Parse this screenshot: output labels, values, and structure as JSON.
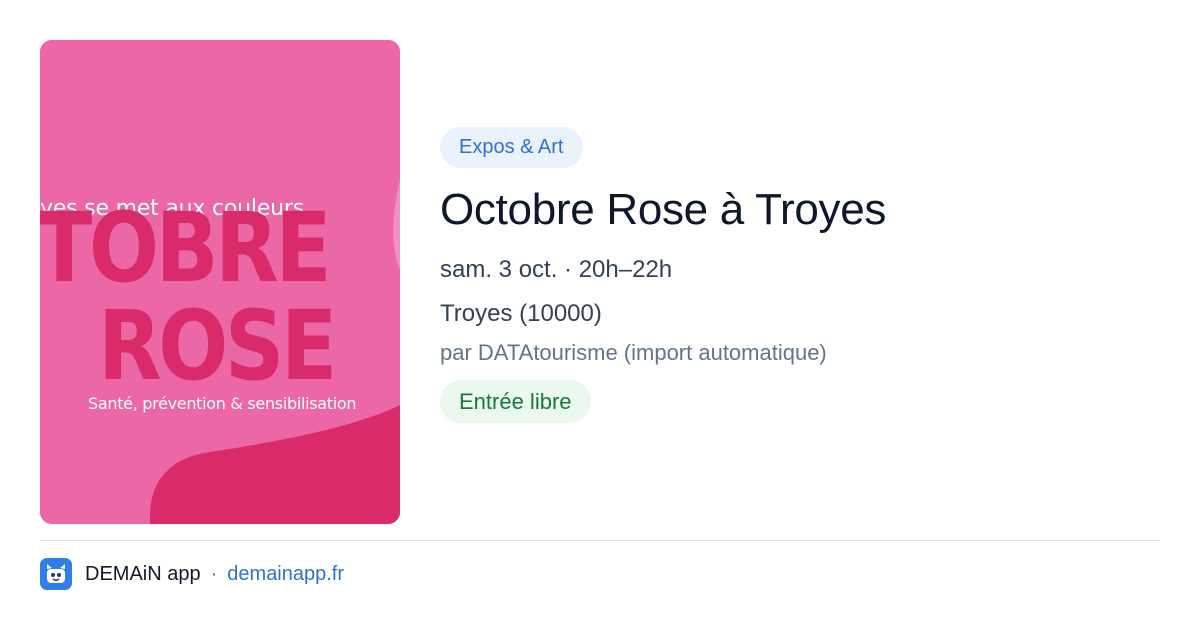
{
  "poster": {
    "tagline": "yes se met aux couleurs",
    "line1": "TOBRE",
    "line2": "ROSE",
    "subtitle": "Santé, prévention & sensibilisation",
    "colors": {
      "background": "#ec67a5",
      "accent": "#d92b6a"
    }
  },
  "event": {
    "category": "Expos & Art",
    "title": "Octobre Rose à Troyes",
    "when": "sam. 3 oct. · 20h–22h",
    "where": "Troyes (10000)",
    "source": "par DATAtourisme (import automatique)",
    "price": "Entrée libre"
  },
  "footer": {
    "app_name": "DEMAiN app",
    "separator": "·",
    "link": "demainapp.fr",
    "logo_icon": "demain-app-logo-icon"
  },
  "colors": {
    "category_bg": "#eaf2fd",
    "category_text": "#2f6fd6",
    "price_bg": "#eaf8ee",
    "price_text": "#177a3c",
    "link": "#2f6fd6"
  }
}
